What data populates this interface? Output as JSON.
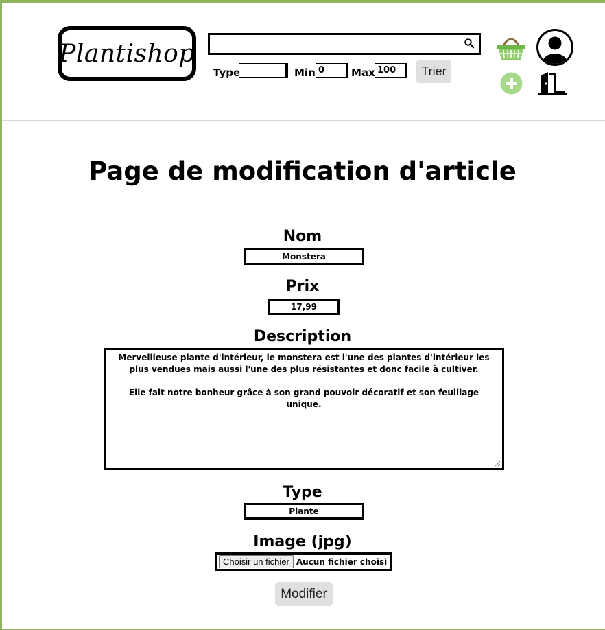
{
  "header": {
    "logo_text": "Plantishop",
    "search": {
      "value": "",
      "placeholder": ""
    },
    "filters": {
      "type_label": "Type",
      "type_value": "",
      "min_label": "Min",
      "min_value": "0",
      "max_label": "Max",
      "max_value": "100",
      "sort_button": "Trier"
    },
    "icons": [
      "basket-icon",
      "user-account-icon",
      "add-item-icon",
      "logout-door-icon"
    ],
    "accent_color": "#8fcc6a"
  },
  "main": {
    "title": "Page de modification d'article",
    "fields": {
      "name_label": "Nom",
      "name_value": "Monstera",
      "price_label": "Prix",
      "price_value": "17,99",
      "description_label": "Description",
      "description_line1": "Merveilleuse plante d'intérieur, le monstera est l'une des plantes d'intérieur les plus vendues mais aussi l'une des plus résistantes et donc facile à cultiver.",
      "description_line2": "Elle fait notre bonheur grâce à son grand pouvoir décoratif et son feuillage unique.",
      "type_label": "Type",
      "type_value": "Plante",
      "image_label": "Image (jpg)",
      "file_button": "Choisir un fichier",
      "file_status": "Aucun fichier choisi"
    },
    "submit_button": "Modifier"
  }
}
